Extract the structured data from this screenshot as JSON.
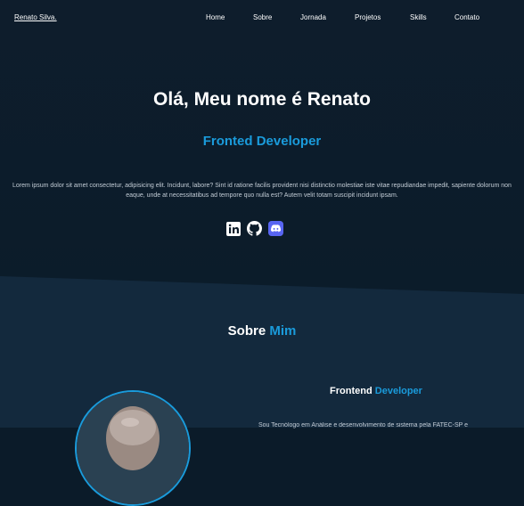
{
  "brand": {
    "logo": "Renato Silva."
  },
  "nav": {
    "items": [
      {
        "label": "Home"
      },
      {
        "label": "Sobre"
      },
      {
        "label": "Jornada"
      },
      {
        "label": "Projetos"
      },
      {
        "label": "Skills"
      },
      {
        "label": "Contato"
      }
    ]
  },
  "hero": {
    "title": "Olá, Meu nome é Renato",
    "subtitle": "Fronted Developer",
    "description": "Lorem ipsum dolor sit amet consectetur, adipisicing elit. Incidunt, labore? Sint id ratione facilis provident nisi distinctio molestiae iste vitae repudiandae impedit, sapiente dolorum non eaque, unde at necessitatibus ad tempore quo nulla est? Autem velit totam suscipit incidunt ipsam.",
    "socials": [
      {
        "icon": "linkedin-icon"
      },
      {
        "icon": "github-icon"
      },
      {
        "icon": "discord-icon"
      }
    ]
  },
  "about": {
    "title_main": "Sobre",
    "title_accent": "Mim",
    "role_main": "Frontend",
    "role_accent": "Developer",
    "text": "Sou Tecnólogo em Análise e desenvolvimento de sistema pela FATEC-SP e"
  },
  "colors": {
    "accent": "#1a9bdb",
    "hero_bg": "#0c1c2b",
    "about_bg": "#13293d"
  }
}
